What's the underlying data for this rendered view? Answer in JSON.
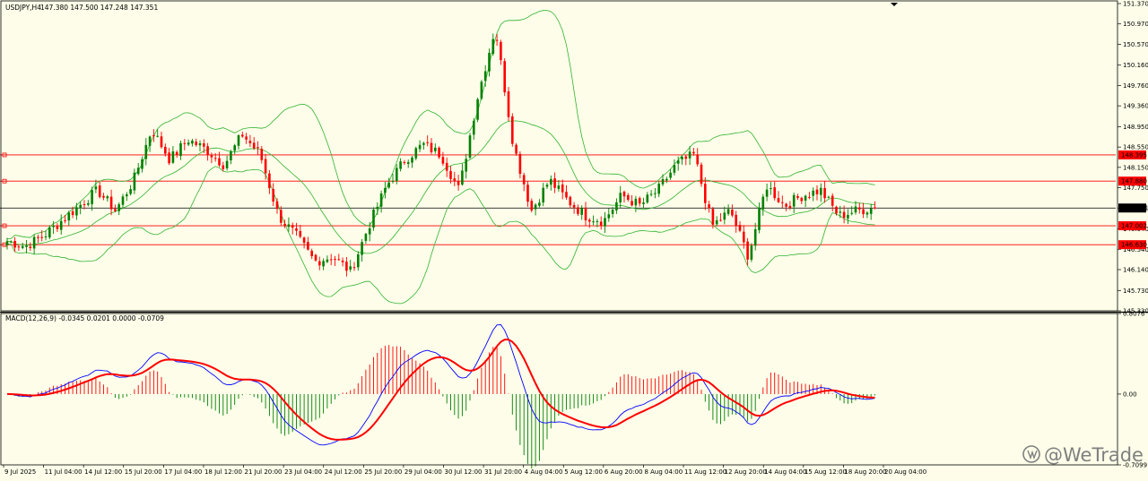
{
  "chart_data": [
    {
      "type": "candlestick",
      "title": "USDJPY,H4",
      "ohlc_header": "147.380 147.500 147.248 147.351",
      "ylim": [
        145.33,
        151.37
      ],
      "y_ticks": [
        "151.370",
        "150.970",
        "150.570",
        "150.160",
        "149.760",
        "149.360",
        "148.950",
        "148.550",
        "148.150",
        "147.750",
        "147.351",
        "146.940",
        "146.540",
        "146.140",
        "145.730",
        "145.330"
      ],
      "price_levels": [
        {
          "value": 148.395,
          "label": "148.395",
          "color": "#ff0000"
        },
        {
          "value": 147.88,
          "label": "147.880",
          "color": "#ff0000"
        },
        {
          "value": 147.002,
          "label": "147.002",
          "color": "#ff0000"
        },
        {
          "value": 146.63,
          "label": "146.630",
          "color": "#ff0000"
        }
      ],
      "current_price": {
        "value": 147.351,
        "label": "147.351"
      },
      "x_labels": [
        "9 Jul 2025",
        "11 Jul 04:00",
        "14 Jul 12:00",
        "15 Jul 20:00",
        "17 Jul 04:00",
        "18 Jul 12:00",
        "21 Jul 20:00",
        "23 Jul 04:00",
        "24 Jul 12:00",
        "25 Jul 20:00",
        "29 Jul 04:00",
        "30 Jul 12:00",
        "31 Jul 20:00",
        "4 Aug 04:00",
        "5 Aug 12:00",
        "6 Aug 20:00",
        "8 Aug 04:00",
        "11 Aug 12:00",
        "12 Aug 20:00",
        "14 Aug 04:00",
        "15 Aug 12:00",
        "18 Aug 20:00",
        "20 Aug 04:00"
      ],
      "close_anchors": [
        146.7,
        146.6,
        146.8,
        147.1,
        147.4,
        147.7,
        147.3,
        147.9,
        148.9,
        148.3,
        148.7,
        148.5,
        148.2,
        148.8,
        148.4,
        147.2,
        146.8,
        146.3,
        146.4,
        146.1,
        147.0,
        147.8,
        148.3,
        148.6,
        148.4,
        147.7,
        149.5,
        150.9,
        148.6,
        147.3,
        147.9,
        147.5,
        147.2,
        147.1,
        147.6,
        147.4,
        147.7,
        148.2,
        148.4,
        147.0,
        147.3,
        146.4,
        147.8,
        147.4,
        147.6,
        147.7,
        147.2,
        147.3,
        147.36
      ],
      "up_color": "#008000",
      "down_color": "#ff0000",
      "bollinger_color": "#32b432"
    },
    {
      "type": "macd",
      "title": "MACD(12,26,9) -0.0345 0.0201 0.0000 -0.0709",
      "ylim": [
        -0.7099,
        0.8076
      ],
      "y_ticks": [
        "0.8076",
        "0.00",
        "-0.7099"
      ],
      "series": [
        {
          "name": "histogram",
          "color_up": "#ff0000",
          "color_down": "#008000"
        },
        {
          "name": "main",
          "color": "#0000ff"
        },
        {
          "name": "signal",
          "color": "#ff0000"
        }
      ]
    }
  ],
  "watermark": "@WeTrade"
}
